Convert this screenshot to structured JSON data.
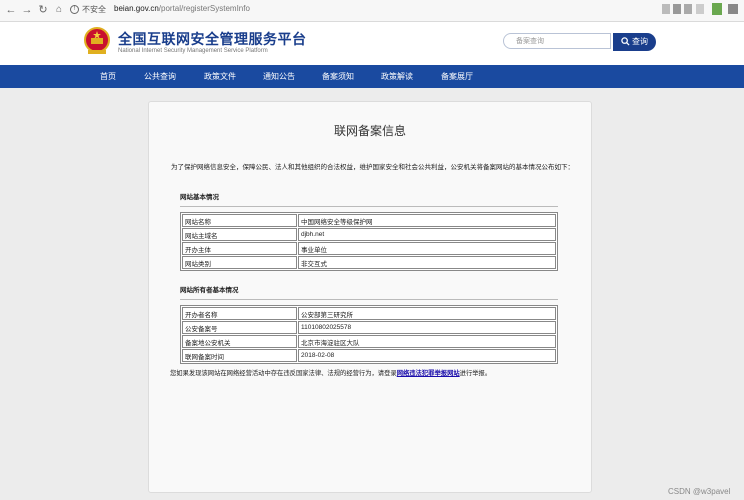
{
  "browser": {
    "security_label": "不安全",
    "url_host": "beian.gov.cn",
    "url_path": "/portal/registerSystemInfo"
  },
  "header": {
    "title": "全国互联网安全管理服务平台",
    "subtitle": "National Internet Security Management Service Platform",
    "search_placeholder": "备案查询",
    "search_button": "查询"
  },
  "nav": {
    "items": [
      "首页",
      "公共查询",
      "政策文件",
      "通知公告",
      "备案须知",
      "政策解读",
      "备案展厅"
    ]
  },
  "content": {
    "title": "联网备案信息",
    "intro": "为了保护网络信息安全，保障公民、法人和其他组织的合法权益，维护国家安全和社会公共利益，公安机关将备案网站的基本情况公布如下：",
    "section1": {
      "heading": "网站基本情况",
      "rows": [
        {
          "k": "网站名称",
          "v": "中国网络安全等级保护网"
        },
        {
          "k": "网站主域名",
          "v": "djbh.net"
        },
        {
          "k": "开办主体",
          "v": "事业单位"
        },
        {
          "k": "网站类别",
          "v": "非交互式"
        }
      ]
    },
    "section2": {
      "heading": "网站所有者基本情况",
      "rows": [
        {
          "k": "开办者名称",
          "v": "公安部第三研究所"
        },
        {
          "k": "公安备案号",
          "v": "11010802025578"
        },
        {
          "k": "备案地公安机关",
          "v": "北京市海淀驻区大队"
        },
        {
          "k": "联网备案时间",
          "v": "2018-02-08"
        }
      ]
    },
    "notice_prefix": "您如果发现该网站在网络经营活动中存在违反国家法律、法规的经营行为，请登录",
    "notice_link": "网络违法犯罪举报网站",
    "notice_suffix": "进行举报。"
  },
  "watermark": "CSDN @w3pavel"
}
